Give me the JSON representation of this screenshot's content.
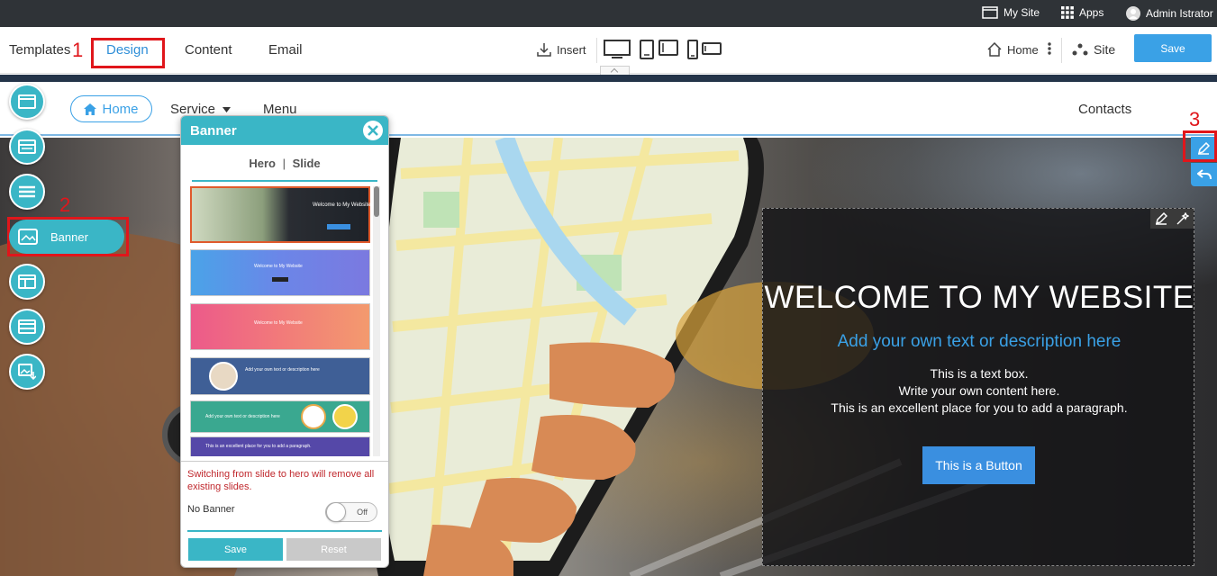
{
  "admin_bar": {
    "my_site": "My Site",
    "apps": "Apps",
    "user": "Admin Istrator"
  },
  "toolbar": {
    "tabs": [
      "Templates",
      "Design",
      "Content",
      "Email"
    ],
    "active_tab": "Design",
    "insert_label": "Insert",
    "home_label": "Home",
    "site_label": "Site",
    "save_label": "Save"
  },
  "annotations": [
    "1",
    "2",
    "3"
  ],
  "site_nav": {
    "home": "Home",
    "service": "Service",
    "menu": "Menu",
    "contacts": "Contacts"
  },
  "side_tools": {
    "banner_label": "Banner"
  },
  "banner_panel": {
    "title": "Banner",
    "tab_hero": "Hero",
    "tab_separator": "|",
    "tab_slide": "Slide",
    "thumbnails": [
      {
        "text": "Welcome to My Website",
        "style": "photo"
      },
      {
        "text": "Welcome to My Website",
        "style": "blue-gradient"
      },
      {
        "text": "Welcome to My Website",
        "style": "pink-gradient"
      },
      {
        "text": "Add your own text or description here",
        "style": "navy-avatar"
      },
      {
        "text": "Add your own text or description here",
        "style": "teal-icons"
      },
      {
        "text": "This is an excellent place for you to add a paragraph.",
        "style": "purple"
      }
    ],
    "warning": "Switching from slide to hero will remove all existing slides.",
    "no_banner_label": "No Banner",
    "toggle_state": "Off",
    "save_label": "Save",
    "reset_label": "Reset"
  },
  "hero": {
    "title": "WELCOME TO MY WEBSITE",
    "subtitle": "Add your own text or description here",
    "paragraph_lines": [
      "This is a text box.",
      "Write your own content here.",
      "This is an excellent place for you to add a paragraph."
    ],
    "button_label": "This is a Button"
  },
  "colors": {
    "accent": "#3aa1e6",
    "teal": "#3ab6c6",
    "annotation_red": "#e0161b",
    "admin_bar": "#2f3337"
  }
}
